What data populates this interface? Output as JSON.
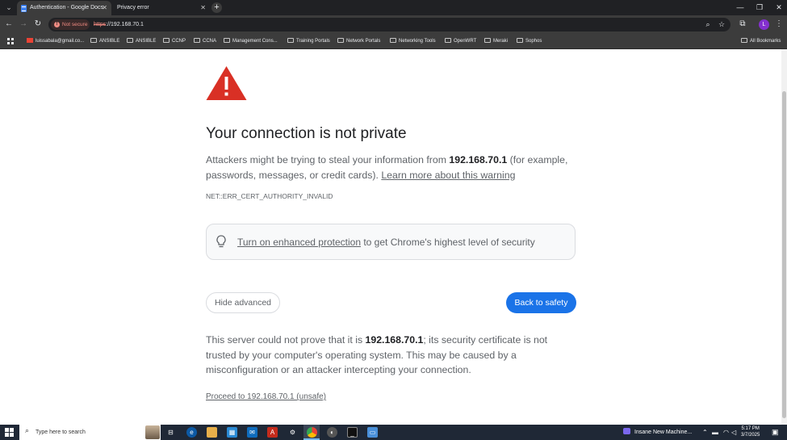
{
  "tabs": [
    {
      "title": "Authentication - Google Docs",
      "active": true
    },
    {
      "title": "Privacy error",
      "active": false
    }
  ],
  "toolbar": {
    "security_label": "Not secure",
    "url_scheme": "https",
    "url_rest": "://192.168.70.1",
    "profile_initial": "L"
  },
  "bookmarks": [
    "luissabala@gmail.co...",
    "ANSIBLE",
    "ANSIBLE",
    "CCNP",
    "CCNA",
    "Management Cons...",
    "Training Portals",
    "Network Portals",
    "Networking Tools",
    "OpenWRT",
    "Meraki",
    "Sophos"
  ],
  "all_bookmarks_label": "All Bookmarks",
  "page": {
    "heading": "Your connection is not private",
    "intro_before": "Attackers might be trying to steal your information from ",
    "host": "192.168.70.1",
    "intro_after": " (for example, passwords, messages, or credit cards). ",
    "learn_more": "Learn more about this warning",
    "error_code": "NET::ERR_CERT_AUTHORITY_INVALID",
    "enhanced_link": "Turn on enhanced protection",
    "enhanced_rest": " to get Chrome's highest level of security",
    "hide_advanced": "Hide advanced",
    "back_to_safety": "Back to safety",
    "detail_before": "This server could not prove that it is ",
    "detail_host": "192.168.70.1",
    "detail_after": "; its security certificate is not trusted by your computer's operating system. This may be caused by a misconfiguration or an attacker intercepting your connection.",
    "proceed": "Proceed to 192.168.70.1 (unsafe)",
    "accent_color": "#1a73e8",
    "warning_color": "#d93025"
  },
  "taskbar": {
    "search_placeholder": "Type here to search",
    "media_title": "Insane New Machine...",
    "time": "5:17 PM",
    "date": "3/7/2025"
  }
}
